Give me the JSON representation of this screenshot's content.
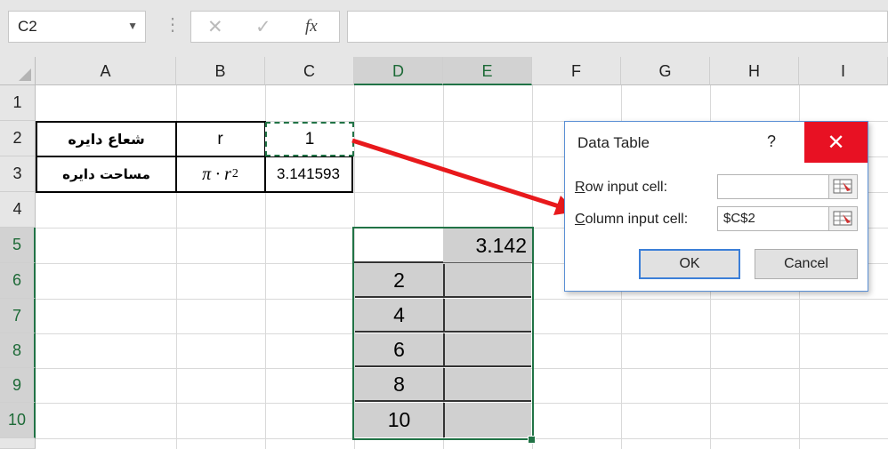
{
  "formula_bar": {
    "name_box": "C2",
    "cancel_symbol": "✕",
    "enter_symbol": "✓",
    "fx_label": "fx",
    "formula": ""
  },
  "columns": [
    "A",
    "B",
    "C",
    "D",
    "E",
    "F",
    "G",
    "H",
    "I"
  ],
  "rows": [
    "1",
    "2",
    "3",
    "4",
    "5",
    "6",
    "7",
    "8",
    "9",
    "10"
  ],
  "cells": {
    "A2": "شعاع دایره",
    "B2": "r",
    "C2": "1",
    "A3": "مساحت دایره",
    "B3_base": "π · r",
    "B3_exp": "2",
    "C3": "3.141593",
    "E5": "3.142",
    "D6": "2",
    "D7": "4",
    "D8": "6",
    "D9": "8",
    "D10": "10"
  },
  "dialog": {
    "title": "Data Table",
    "help": "?",
    "close": "✕",
    "row_input_label_u": "R",
    "row_input_label_rest": "ow input cell:",
    "row_input_value": "",
    "col_input_label_u": "C",
    "col_input_label_rest": "olumn input cell:",
    "col_input_value": "$C$2",
    "ok": "OK",
    "cancel": "Cancel"
  },
  "colors": {
    "accent_green": "#217346",
    "arrow_red": "#e8191c",
    "close_red": "#e81123",
    "dialog_border": "#5a8fd4"
  }
}
